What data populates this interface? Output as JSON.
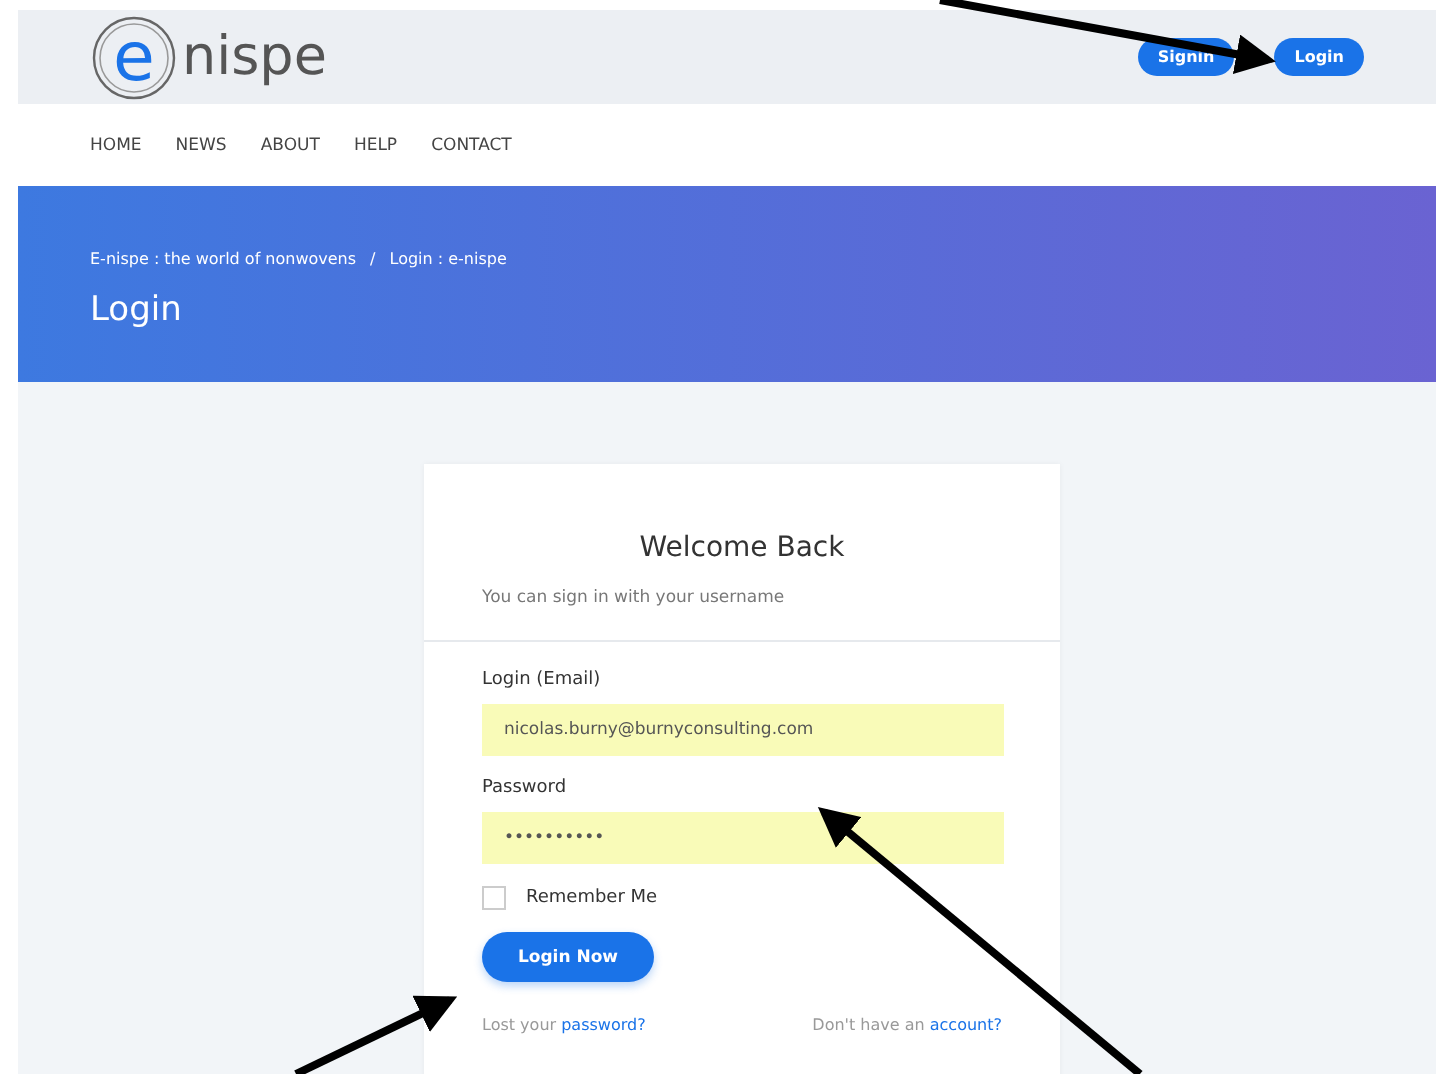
{
  "header": {
    "logo": {
      "initial": "e",
      "rest": "nispe"
    },
    "buttons": [
      "Signin",
      "Login"
    ]
  },
  "nav": [
    "HOME",
    "NEWS",
    "ABOUT",
    "HELP",
    "CONTACT"
  ],
  "banner": {
    "breadcrumb": [
      "E-nispe : the world of nonwovens",
      "Login : e-nispe"
    ],
    "separator": "/",
    "title": "Login"
  },
  "card": {
    "title": "Welcome Back",
    "subtitle": "You can sign in with your username",
    "fields": [
      {
        "label": "Login (Email)",
        "value": "nicolas.burny@burnyconsulting.com"
      },
      {
        "label": "Password",
        "value": "••••••••••"
      }
    ],
    "remember": {
      "label": "Remember Me",
      "checked": false
    },
    "submit": "Login Now",
    "links": [
      {
        "text": "Lost your ",
        "link": "password?"
      },
      {
        "text": "Don't have an ",
        "link": "account?"
      }
    ]
  }
}
